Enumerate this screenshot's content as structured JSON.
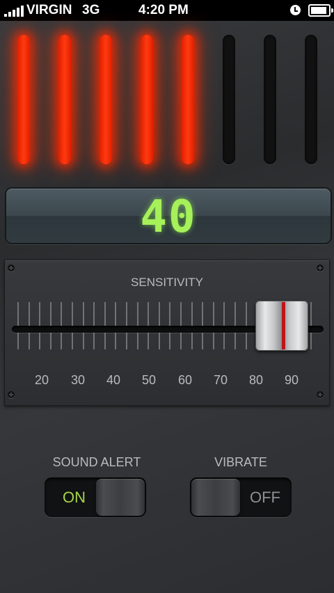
{
  "status_bar": {
    "carrier": "VIRGIN",
    "network": "3G",
    "time": "4:20 PM",
    "alarm_icon": "alarm-clock-icon",
    "battery_icon": "battery-full-icon"
  },
  "meter": {
    "total_bars": 8,
    "lit_bars": 5,
    "lit_color": "#ff2a00",
    "unlit_color": "#111111"
  },
  "readout": {
    "value": "40",
    "color": "#a6f05a"
  },
  "sensitivity": {
    "title": "SENSITIVITY",
    "scale": [
      "20",
      "30",
      "40",
      "50",
      "60",
      "70",
      "80",
      "90"
    ],
    "level_fraction": 0.94
  },
  "sound_alert": {
    "label": "SOUND ALERT",
    "state_text": "ON",
    "on_color": "#a6d64a"
  },
  "vibrate": {
    "label": "VIBRATE",
    "state_text": "OFF",
    "off_color": "#8e9093"
  }
}
